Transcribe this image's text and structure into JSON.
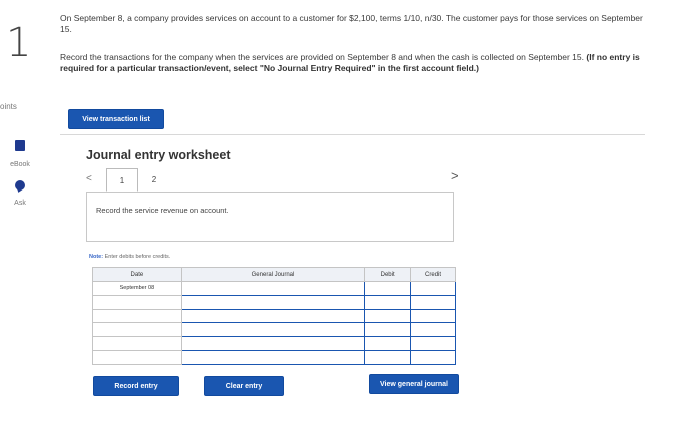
{
  "question": {
    "number": "1",
    "points_label": "oints",
    "text": "On September 8, a company provides services on account to a customer for $2,100, terms 1/10, n/30. The customer pays for those services on September 15.",
    "instructions_plain": "Record the transactions for the company when the services are provided on September 8 and when the cash is collected on September 15.",
    "instructions_bold": "(If no entry is required for a particular transaction/event, select \"No Journal Entry Required\" in the first account field.)"
  },
  "rail": {
    "ebook_label": "eBook",
    "ask_label": "Ask"
  },
  "buttons": {
    "view_transaction_list": "View transaction list",
    "record_entry": "Record entry",
    "clear_entry": "Clear entry",
    "view_general_journal": "View general journal"
  },
  "worksheet": {
    "title": "Journal entry worksheet",
    "pages": [
      "1",
      "2"
    ],
    "prev": "<",
    "next": ">",
    "description": "Record the service revenue on account.",
    "note_prefix": "Note:",
    "note_text": " Enter debits before credits."
  },
  "table": {
    "headers": {
      "date": "Date",
      "account": "General Journal",
      "debit": "Debit",
      "credit": "Credit"
    },
    "rows": [
      {
        "date": "September 08",
        "account": "",
        "debit": "",
        "credit": ""
      },
      {
        "date": "",
        "account": "",
        "debit": "",
        "credit": ""
      },
      {
        "date": "",
        "account": "",
        "debit": "",
        "credit": ""
      },
      {
        "date": "",
        "account": "",
        "debit": "",
        "credit": ""
      },
      {
        "date": "",
        "account": "",
        "debit": "",
        "credit": ""
      },
      {
        "date": "",
        "account": "",
        "debit": "",
        "credit": ""
      }
    ]
  },
  "icons": {
    "ebook": "book-icon",
    "ask": "chat-bubble-icon",
    "prev": "chevron-left-icon",
    "next": "chevron-right-icon"
  },
  "colors": {
    "primary": "#1a56b0",
    "note_accent": "#3766c7"
  }
}
